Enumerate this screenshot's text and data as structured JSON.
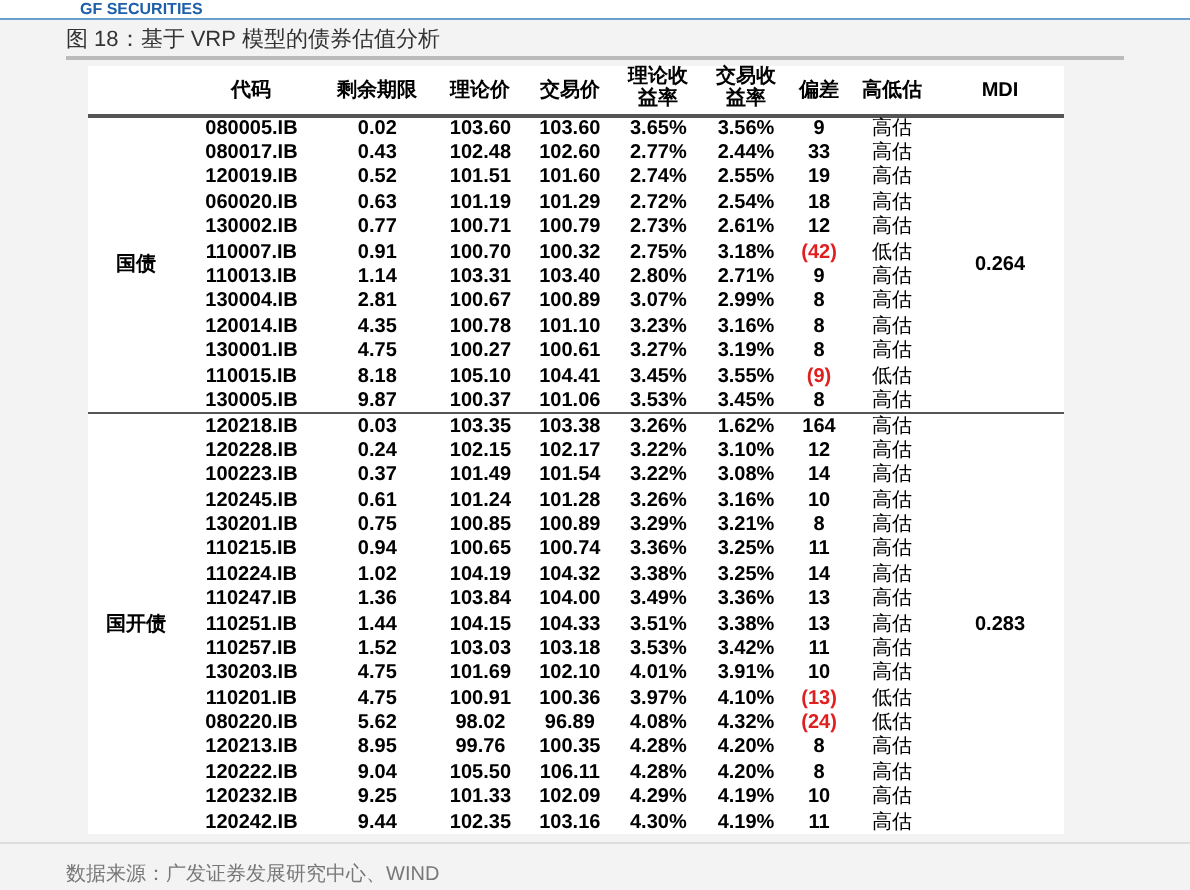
{
  "logo": {
    "text": "GF SECURITIES"
  },
  "figure_title": "图 18：基于 VRP 模型的债券估值分析",
  "table": {
    "columns": [
      "代码",
      "剩余期限",
      "理论价",
      "交易价",
      "理论收益率",
      "交易收益率",
      "偏差",
      "高低估",
      "MDI"
    ],
    "groups": [
      {
        "name": "国债",
        "mdi": "0.264",
        "rows": [
          {
            "code": "080005.IB",
            "remaining": "0.02",
            "theory_price": "103.60",
            "trade_price": "103.60",
            "theory_yield": "3.65%",
            "trade_yield": "3.56%",
            "deviation": "9",
            "negative": false,
            "valuation": "高估"
          },
          {
            "code": "080017.IB",
            "remaining": "0.43",
            "theory_price": "102.48",
            "trade_price": "102.60",
            "theory_yield": "2.77%",
            "trade_yield": "2.44%",
            "deviation": "33",
            "negative": false,
            "valuation": "高估"
          },
          {
            "code": "120019.IB",
            "remaining": "0.52",
            "theory_price": "101.51",
            "trade_price": "101.60",
            "theory_yield": "2.74%",
            "trade_yield": "2.55%",
            "deviation": "19",
            "negative": false,
            "valuation": "高估"
          },
          {
            "code": "060020.IB",
            "remaining": "0.63",
            "theory_price": "101.19",
            "trade_price": "101.29",
            "theory_yield": "2.72%",
            "trade_yield": "2.54%",
            "deviation": "18",
            "negative": false,
            "valuation": "高估"
          },
          {
            "code": "130002.IB",
            "remaining": "0.77",
            "theory_price": "100.71",
            "trade_price": "100.79",
            "theory_yield": "2.73%",
            "trade_yield": "2.61%",
            "deviation": "12",
            "negative": false,
            "valuation": "高估"
          },
          {
            "code": "110007.IB",
            "remaining": "0.91",
            "theory_price": "100.70",
            "trade_price": "100.32",
            "theory_yield": "2.75%",
            "trade_yield": "3.18%",
            "deviation": "(42)",
            "negative": true,
            "valuation": "低估"
          },
          {
            "code": "110013.IB",
            "remaining": "1.14",
            "theory_price": "103.31",
            "trade_price": "103.40",
            "theory_yield": "2.80%",
            "trade_yield": "2.71%",
            "deviation": "9",
            "negative": false,
            "valuation": "高估"
          },
          {
            "code": "130004.IB",
            "remaining": "2.81",
            "theory_price": "100.67",
            "trade_price": "100.89",
            "theory_yield": "3.07%",
            "trade_yield": "2.99%",
            "deviation": "8",
            "negative": false,
            "valuation": "高估"
          },
          {
            "code": "120014.IB",
            "remaining": "4.35",
            "theory_price": "100.78",
            "trade_price": "101.10",
            "theory_yield": "3.23%",
            "trade_yield": "3.16%",
            "deviation": "8",
            "negative": false,
            "valuation": "高估"
          },
          {
            "code": "130001.IB",
            "remaining": "4.75",
            "theory_price": "100.27",
            "trade_price": "100.61",
            "theory_yield": "3.27%",
            "trade_yield": "3.19%",
            "deviation": "8",
            "negative": false,
            "valuation": "高估"
          },
          {
            "code": "110015.IB",
            "remaining": "8.18",
            "theory_price": "105.10",
            "trade_price": "104.41",
            "theory_yield": "3.45%",
            "trade_yield": "3.55%",
            "deviation": "(9)",
            "negative": true,
            "valuation": "低估"
          },
          {
            "code": "130005.IB",
            "remaining": "9.87",
            "theory_price": "100.37",
            "trade_price": "101.06",
            "theory_yield": "3.53%",
            "trade_yield": "3.45%",
            "deviation": "8",
            "negative": false,
            "valuation": "高估"
          }
        ]
      },
      {
        "name": "国开债",
        "mdi": "0.283",
        "rows": [
          {
            "code": "120218.IB",
            "remaining": "0.03",
            "theory_price": "103.35",
            "trade_price": "103.38",
            "theory_yield": "3.26%",
            "trade_yield": "1.62%",
            "deviation": "164",
            "negative": false,
            "valuation": "高估"
          },
          {
            "code": "120228.IB",
            "remaining": "0.24",
            "theory_price": "102.15",
            "trade_price": "102.17",
            "theory_yield": "3.22%",
            "trade_yield": "3.10%",
            "deviation": "12",
            "negative": false,
            "valuation": "高估"
          },
          {
            "code": "100223.IB",
            "remaining": "0.37",
            "theory_price": "101.49",
            "trade_price": "101.54",
            "theory_yield": "3.22%",
            "trade_yield": "3.08%",
            "deviation": "14",
            "negative": false,
            "valuation": "高估"
          },
          {
            "code": "120245.IB",
            "remaining": "0.61",
            "theory_price": "101.24",
            "trade_price": "101.28",
            "theory_yield": "3.26%",
            "trade_yield": "3.16%",
            "deviation": "10",
            "negative": false,
            "valuation": "高估"
          },
          {
            "code": "130201.IB",
            "remaining": "0.75",
            "theory_price": "100.85",
            "trade_price": "100.89",
            "theory_yield": "3.29%",
            "trade_yield": "3.21%",
            "deviation": "8",
            "negative": false,
            "valuation": "高估"
          },
          {
            "code": "110215.IB",
            "remaining": "0.94",
            "theory_price": "100.65",
            "trade_price": "100.74",
            "theory_yield": "3.36%",
            "trade_yield": "3.25%",
            "deviation": "11",
            "negative": false,
            "valuation": "高估"
          },
          {
            "code": "110224.IB",
            "remaining": "1.02",
            "theory_price": "104.19",
            "trade_price": "104.32",
            "theory_yield": "3.38%",
            "trade_yield": "3.25%",
            "deviation": "14",
            "negative": false,
            "valuation": "高估"
          },
          {
            "code": "110247.IB",
            "remaining": "1.36",
            "theory_price": "103.84",
            "trade_price": "104.00",
            "theory_yield": "3.49%",
            "trade_yield": "3.36%",
            "deviation": "13",
            "negative": false,
            "valuation": "高估"
          },
          {
            "code": "110251.IB",
            "remaining": "1.44",
            "theory_price": "104.15",
            "trade_price": "104.33",
            "theory_yield": "3.51%",
            "trade_yield": "3.38%",
            "deviation": "13",
            "negative": false,
            "valuation": "高估"
          },
          {
            "code": "110257.IB",
            "remaining": "1.52",
            "theory_price": "103.03",
            "trade_price": "103.18",
            "theory_yield": "3.53%",
            "trade_yield": "3.42%",
            "deviation": "11",
            "negative": false,
            "valuation": "高估"
          },
          {
            "code": "130203.IB",
            "remaining": "4.75",
            "theory_price": "101.69",
            "trade_price": "102.10",
            "theory_yield": "4.01%",
            "trade_yield": "3.91%",
            "deviation": "10",
            "negative": false,
            "valuation": "高估"
          },
          {
            "code": "110201.IB",
            "remaining": "4.75",
            "theory_price": "100.91",
            "trade_price": "100.36",
            "theory_yield": "3.97%",
            "trade_yield": "4.10%",
            "deviation": "(13)",
            "negative": true,
            "valuation": "低估"
          },
          {
            "code": "080220.IB",
            "remaining": "5.62",
            "theory_price": "98.02",
            "trade_price": "96.89",
            "theory_yield": "4.08%",
            "trade_yield": "4.32%",
            "deviation": "(24)",
            "negative": true,
            "valuation": "低估"
          },
          {
            "code": "120213.IB",
            "remaining": "8.95",
            "theory_price": "99.76",
            "trade_price": "100.35",
            "theory_yield": "4.28%",
            "trade_yield": "4.20%",
            "deviation": "8",
            "negative": false,
            "valuation": "高估"
          },
          {
            "code": "120222.IB",
            "remaining": "9.04",
            "theory_price": "105.50",
            "trade_price": "106.11",
            "theory_yield": "4.28%",
            "trade_yield": "4.20%",
            "deviation": "8",
            "negative": false,
            "valuation": "高估"
          },
          {
            "code": "120232.IB",
            "remaining": "9.25",
            "theory_price": "101.33",
            "trade_price": "102.09",
            "theory_yield": "4.29%",
            "trade_yield": "4.19%",
            "deviation": "10",
            "negative": false,
            "valuation": "高估"
          },
          {
            "code": "120242.IB",
            "remaining": "9.44",
            "theory_price": "102.35",
            "trade_price": "103.16",
            "theory_yield": "4.30%",
            "trade_yield": "4.19%",
            "deviation": "11",
            "negative": false,
            "valuation": "高估"
          }
        ]
      }
    ]
  },
  "source": "数据来源：广发证券发展研究中心、WIND"
}
